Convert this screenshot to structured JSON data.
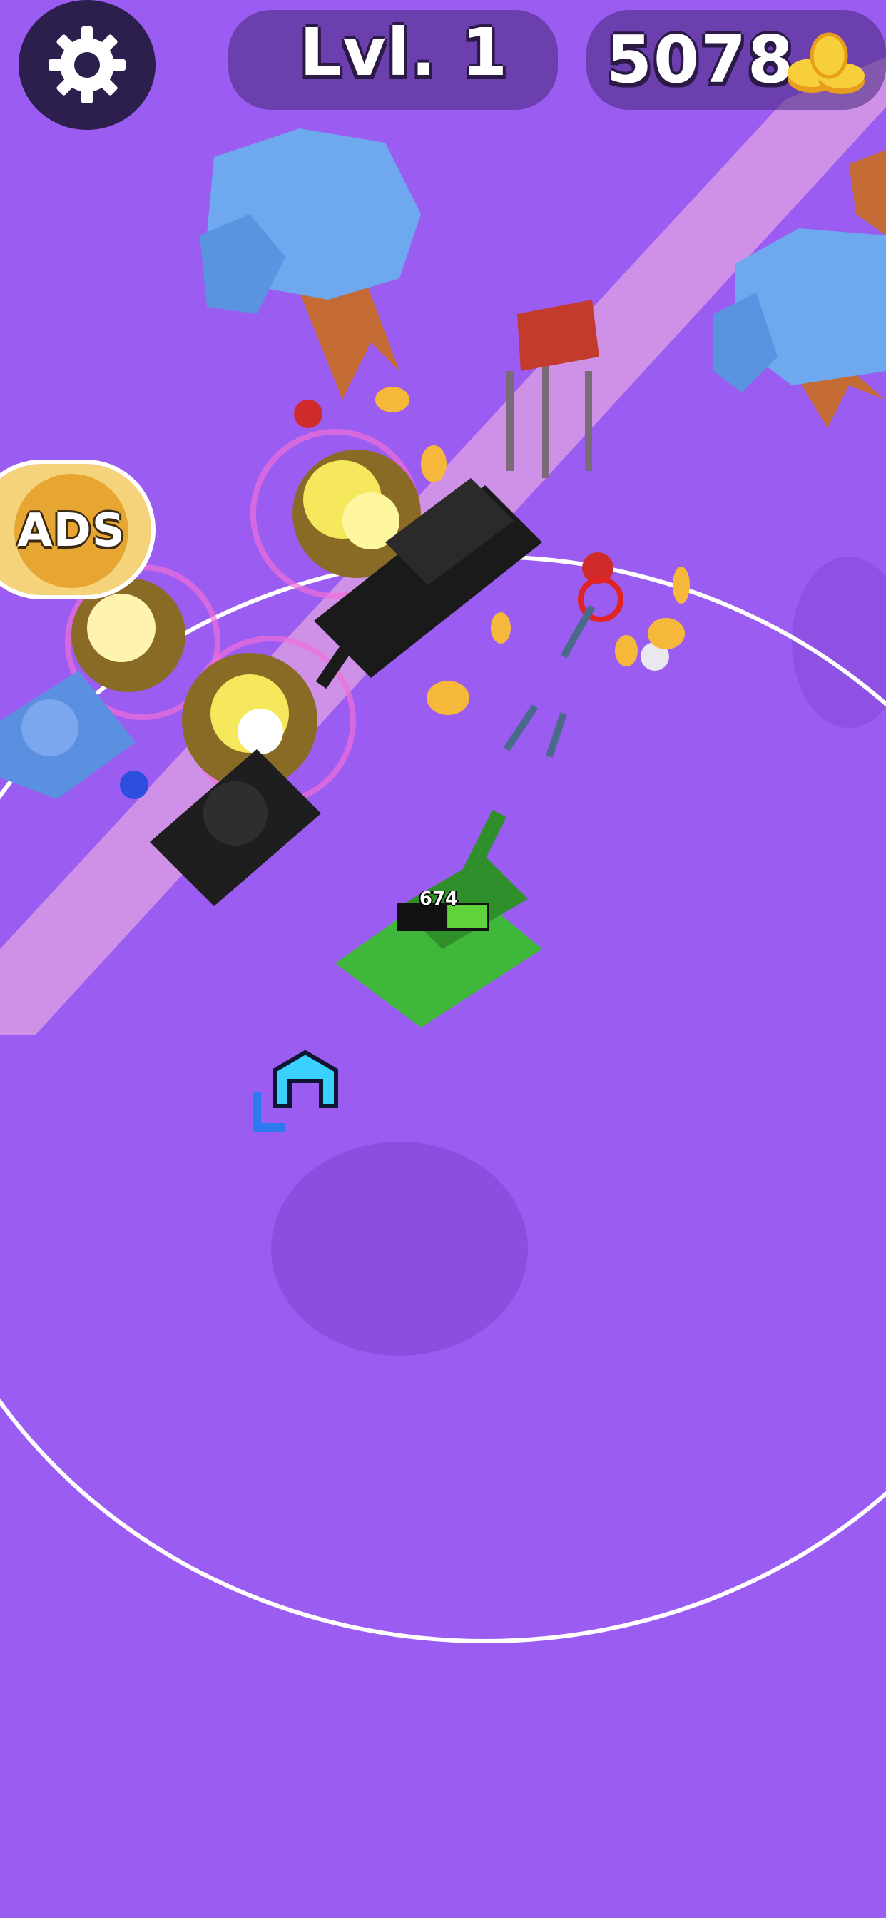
{
  "hud": {
    "level_label": "Lvl. 1",
    "coins": "5078",
    "settings_icon": "gear-icon",
    "coin_icon": "coin-stack-icon"
  },
  "ads_button": {
    "label": "ADS"
  },
  "player": {
    "hp": "674",
    "hp_fraction": 0.45
  },
  "colors": {
    "ground": "#9b5cf2",
    "road": "#d89ae6",
    "player_tank": "#3fb73a",
    "enemy_tank": "#1a1a1a",
    "ally_tank": "#5b8fe0",
    "coin": "#f5b83a"
  }
}
